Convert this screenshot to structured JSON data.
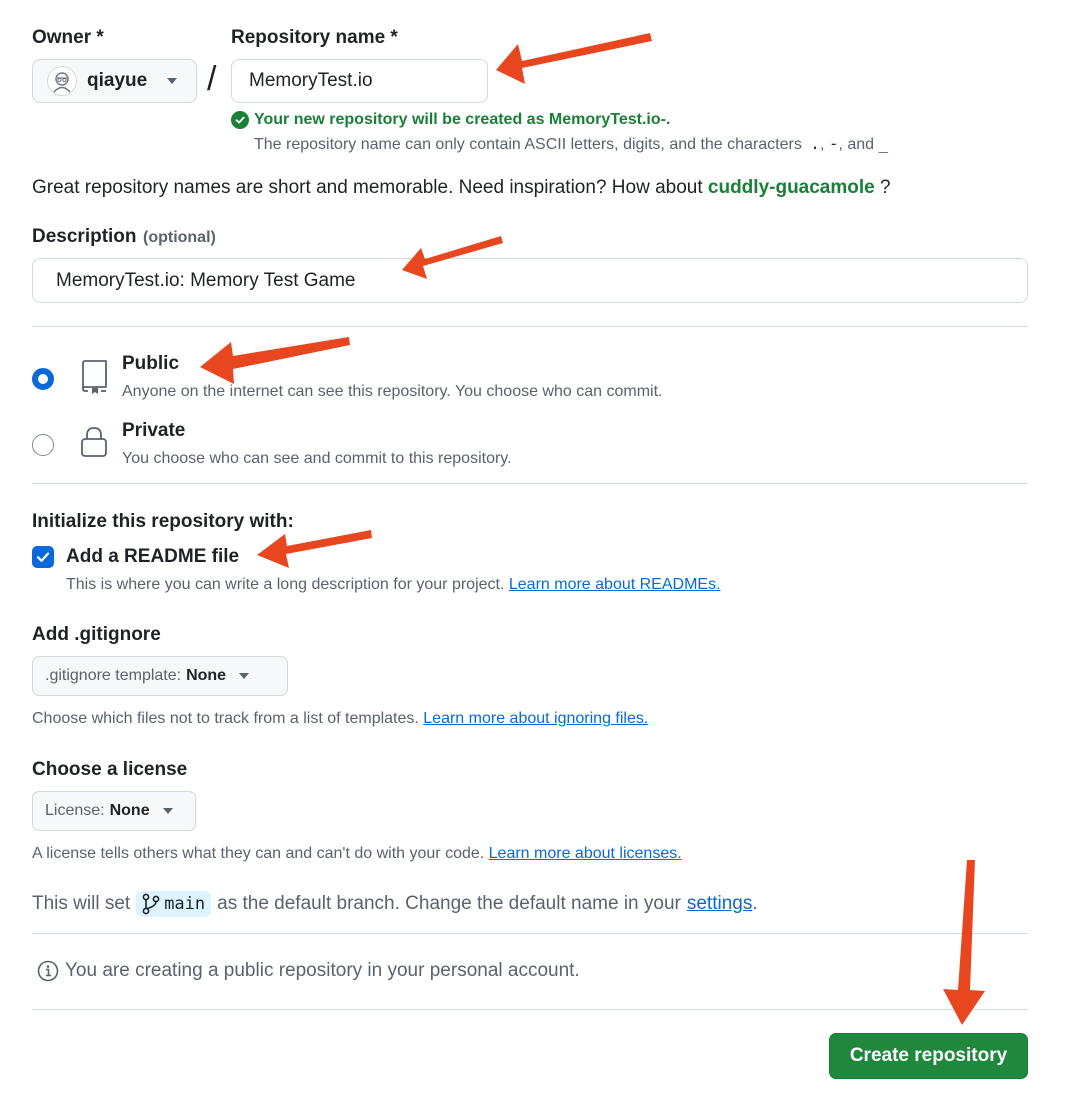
{
  "owner": {
    "label": "Owner *",
    "value": "qiayue"
  },
  "repo": {
    "label": "Repository name *",
    "value": "MemoryTest.io",
    "separator": "/",
    "success_msg": "Your new repository will be created as MemoryTest.io-.",
    "rules_text": "The repository name can only contain ASCII letters, digits, and the characters",
    "rules_chars": [
      ".",
      "-",
      "_"
    ],
    "rules_sep_comma": ",",
    "rules_sep_and": ", and"
  },
  "inspiration": {
    "text": "Great repository names are short and memorable. Need inspiration? How about",
    "suggestion": "cuddly-guacamole",
    "suffix": "?"
  },
  "description": {
    "label": "Description",
    "optional": "(optional)",
    "value": "MemoryTest.io: Memory Test Game"
  },
  "visibility": {
    "public": {
      "title": "Public",
      "desc": "Anyone on the internet can see this repository. You choose who can commit.",
      "selected": true,
      "icon": "repo-icon"
    },
    "private": {
      "title": "Private",
      "desc": "You choose who can see and commit to this repository.",
      "selected": false,
      "icon": "lock-icon"
    }
  },
  "init": {
    "heading": "Initialize this repository with:",
    "readme_label": "Add a README file",
    "readme_checked": true,
    "readme_desc": "This is where you can write a long description for your project.",
    "readme_link": "Learn more about READMEs."
  },
  "gitignore": {
    "heading": "Add .gitignore",
    "select_prefix": ".gitignore template:",
    "select_value": "None",
    "desc": "Choose which files not to track from a list of templates.",
    "link": "Learn more about ignoring files."
  },
  "license": {
    "heading": "Choose a license",
    "select_prefix": "License:",
    "select_value": "None",
    "desc": "A license tells others what they can and can't do with your code.",
    "link": "Learn more about licenses."
  },
  "branch": {
    "prefix": "This will set",
    "name": "main",
    "middle": "as the default branch. Change the default name in your",
    "link": "settings",
    "suffix": "."
  },
  "notice": {
    "text": "You are creating a public repository in your personal account.",
    "icon": "info-icon"
  },
  "submit": {
    "label": "Create repository"
  },
  "colors": {
    "primary_button": "#1f883d",
    "success_text": "#1a7f37",
    "link": "#0969da",
    "annotation_arrow": "#e8461f"
  }
}
